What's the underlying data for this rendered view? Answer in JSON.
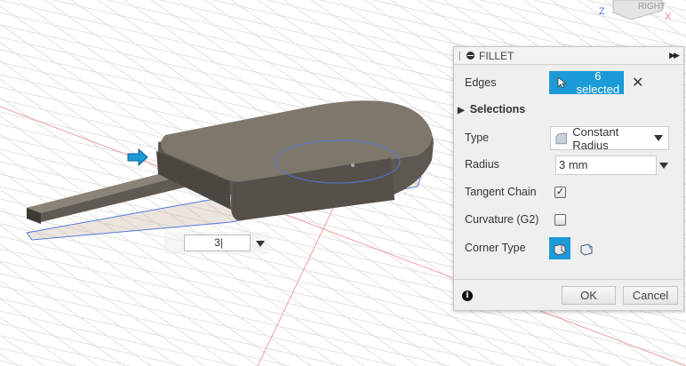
{
  "viewcube": {
    "face_label": "RIGHT",
    "axis_z": "Z",
    "axis_x": "X"
  },
  "value_input": {
    "value": "3"
  },
  "fillet": {
    "title": "FILLET",
    "edges_label": "Edges",
    "edges_value": "6 selected",
    "selections_label": "Selections",
    "type_label": "Type",
    "type_value": "Constant Radius",
    "radius_label": "Radius",
    "radius_value": "3 mm",
    "tangent_label": "Tangent Chain",
    "tangent_checked": true,
    "tangent_mark": "✓",
    "curvature_label": "Curvature (G2)",
    "curvature_checked": false,
    "corner_label": "Corner Type",
    "ok_label": "OK",
    "cancel_label": "Cancel",
    "info_glyph": "i",
    "close_glyph": "✕"
  },
  "colors": {
    "accent": "#1a9ad6",
    "body": "#6f6a60",
    "grid": "#dcdcdc",
    "axis_red": "#e88",
    "axis_blue": "#5577dd"
  }
}
